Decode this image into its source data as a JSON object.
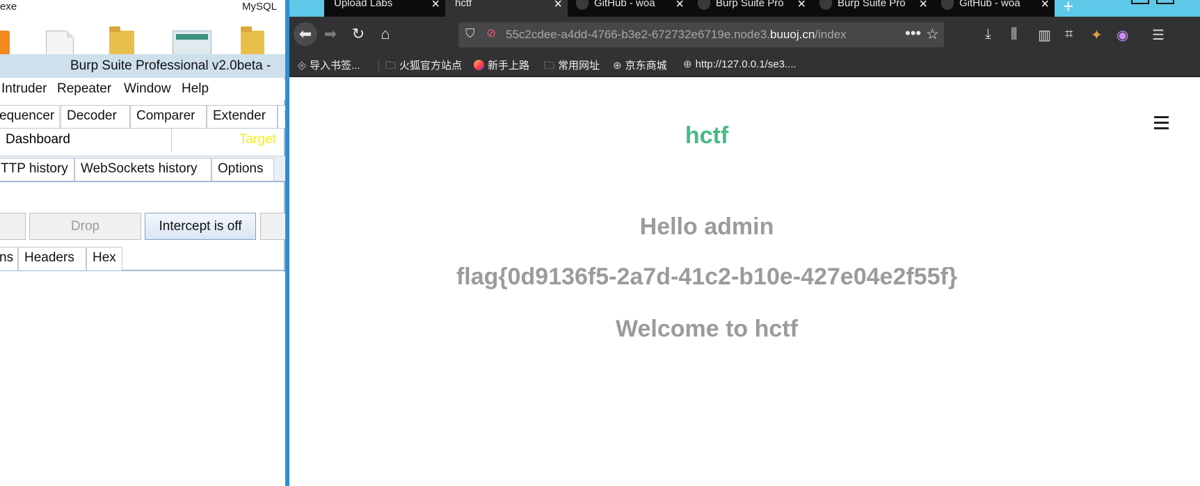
{
  "desktop": {
    "labels": [
      "exe",
      "MySQL"
    ],
    "icons": [
      "orange-app-icon",
      "document-icon",
      "folder-icon",
      "image-file-icon",
      "folder-icon"
    ]
  },
  "burp": {
    "title": "Burp Suite Professional v2.0beta -",
    "menu": [
      "Intruder",
      "Repeater",
      "Window",
      "Help"
    ],
    "tools": [
      "equencer",
      "Decoder",
      "Comparer",
      "Extender",
      "I"
    ],
    "dashboard": "Dashboard",
    "target": "Target",
    "proxy_tabs": [
      "TTP history",
      "WebSockets history",
      "Options"
    ],
    "buttons": {
      "drop": "Drop",
      "intercept": "Intercept is off"
    },
    "message_tabs": [
      "ns",
      "Headers",
      "Hex"
    ],
    "colors": {
      "title_bar": "#cde0ec",
      "target": "#f2f217"
    }
  },
  "browser": {
    "tabs": [
      {
        "label": "Upload Labs",
        "github": false,
        "active": false
      },
      {
        "label": "hctf",
        "github": false,
        "active": true
      },
      {
        "label": "GitHub - woa",
        "github": true,
        "active": false
      },
      {
        "label": "Burp Suite Pro",
        "github": true,
        "active": false
      },
      {
        "label": "Burp Suite Pro",
        "github": true,
        "active": false
      },
      {
        "label": "GitHub - woa",
        "github": true,
        "active": false
      }
    ],
    "url": {
      "prefix": "55c2cdee-a4dd-4766-b3e2-672732e6719e.node3.",
      "domain": "buuoj.cn",
      "path": "/index"
    },
    "bookmarks": [
      "导入书签...",
      "火狐官方站点",
      "新手上路",
      "常用网址",
      "京东商城",
      "http://127.0.0.1/se3...."
    ],
    "colors": {
      "tabstrip": "#5ec8e8",
      "toolbar": "#323234",
      "lock": "#e25c6b"
    }
  },
  "page": {
    "brand": "hctf",
    "greeting": "Hello admin",
    "flag": "flag{0d9136f5-2a7d-41c2-b10e-427e04e2f55f}",
    "welcome": "Welcome to hctf",
    "colors": {
      "brand": "#45bc83",
      "text": "#9b9b9b"
    }
  }
}
